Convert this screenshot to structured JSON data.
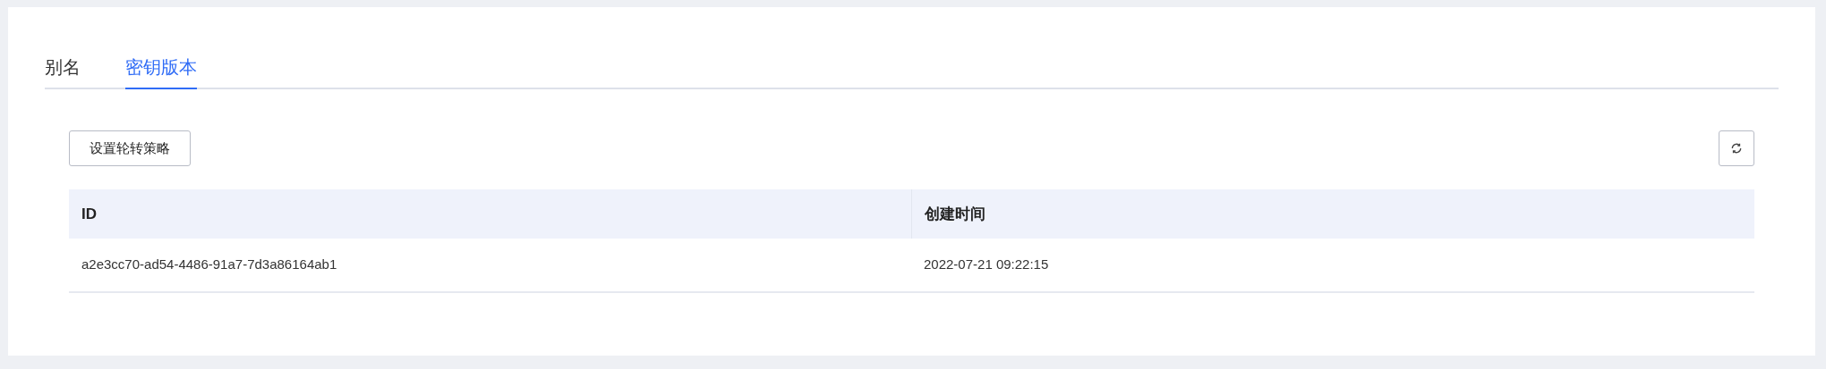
{
  "tabs": [
    {
      "label": "别名",
      "selected": false
    },
    {
      "label": "密钥版本",
      "selected": true
    }
  ],
  "toolbar": {
    "button": "设置轮转策略"
  },
  "table": {
    "columns": [
      "ID",
      "创建时间"
    ],
    "rows": [
      [
        "a2e3cc70-ad54-4486-91a7-7d3a86164ab1",
        "2022-07-21 09:22:15"
      ]
    ]
  }
}
